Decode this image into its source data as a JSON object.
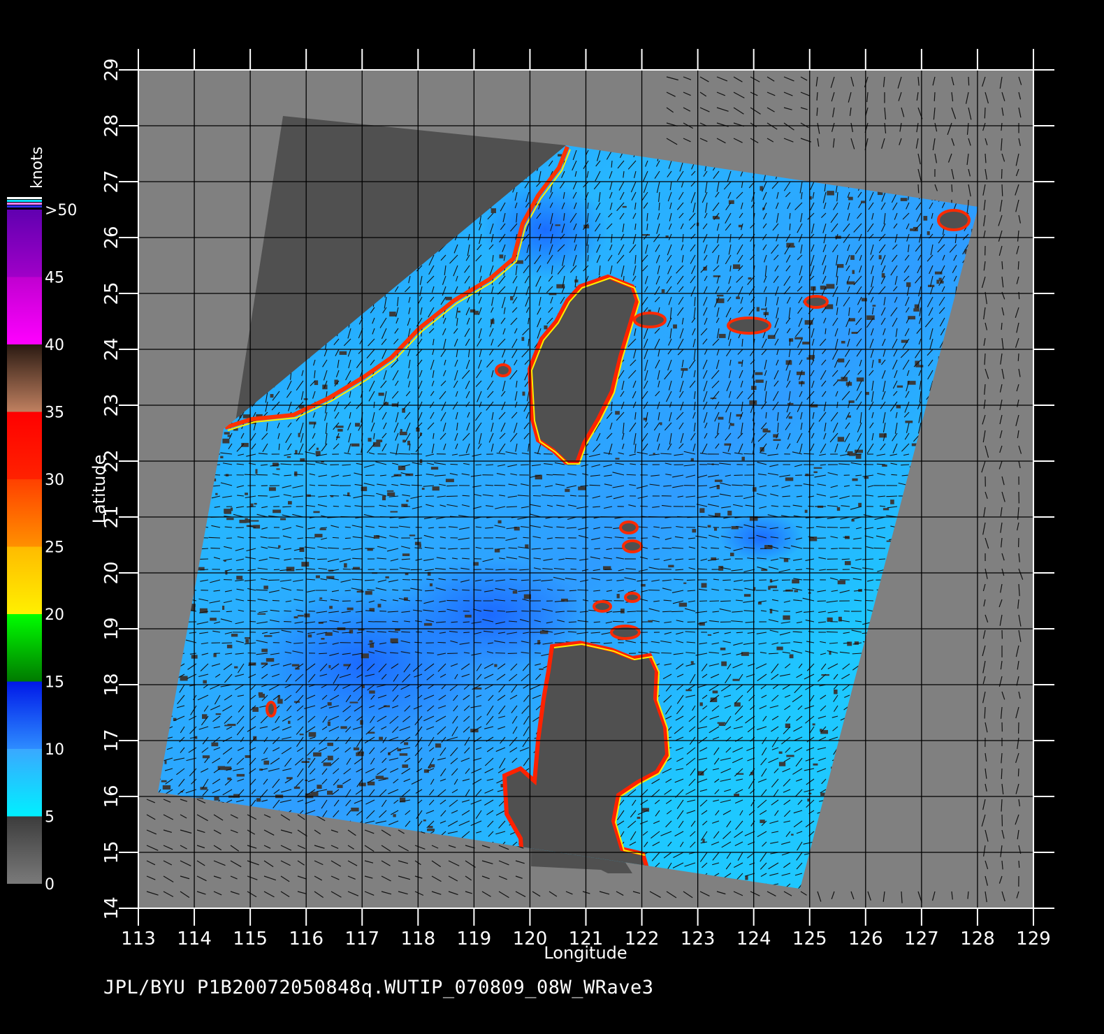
{
  "map": {
    "longitude_label": "Longitude",
    "latitude_label": "Latitude",
    "lon_range": [
      113,
      129
    ],
    "lat_range": [
      14,
      29
    ],
    "lon_ticks": [
      "113",
      "114",
      "115",
      "116",
      "117",
      "118",
      "119",
      "120",
      "121",
      "122",
      "123",
      "124",
      "125",
      "126",
      "127",
      "128",
      "129"
    ],
    "lat_ticks": [
      "14",
      "15",
      "16",
      "17",
      "18",
      "19",
      "20",
      "21",
      "22",
      "23",
      "24",
      "25",
      "26",
      "27",
      "28",
      "29"
    ],
    "background_color": "#808080",
    "land_color": "#505050",
    "grid": true,
    "wind_vectors": true
  },
  "colorbar": {
    "unit_label": "knots",
    "labels": [
      "0",
      "5",
      "10",
      "15",
      "20",
      "25",
      "30",
      "35",
      "40",
      "45",
      ">50"
    ],
    "bands": [
      {
        "from": 0,
        "to": 5,
        "colors": [
          "#7a7a7a",
          "#3c3c3c"
        ]
      },
      {
        "from": 5,
        "to": 10,
        "colors": [
          "#00f0ff",
          "#3aa8ff"
        ]
      },
      {
        "from": 10,
        "to": 15,
        "colors": [
          "#2d8cff",
          "#0018e8"
        ]
      },
      {
        "from": 15,
        "to": 20,
        "colors": [
          "#007a00",
          "#00ff00"
        ]
      },
      {
        "from": 20,
        "to": 25,
        "colors": [
          "#fff000",
          "#ffbb00"
        ]
      },
      {
        "from": 25,
        "to": 30,
        "colors": [
          "#ff9000",
          "#ff4000"
        ]
      },
      {
        "from": 30,
        "to": 35,
        "colors": [
          "#ff2200",
          "#ff0000"
        ]
      },
      {
        "from": 35,
        "to": 40,
        "colors": [
          "#c08060",
          "#2a1a12"
        ]
      },
      {
        "from": 40,
        "to": 45,
        "colors": [
          "#ff00ff",
          "#c000d0"
        ]
      },
      {
        "from": 45,
        "to": 50,
        "colors": [
          "#a000c8",
          "#6000b0"
        ]
      }
    ]
  },
  "footer": "JPL/BYU  P1B20072050848q.WUTIP_070809_08W_WRave3"
}
